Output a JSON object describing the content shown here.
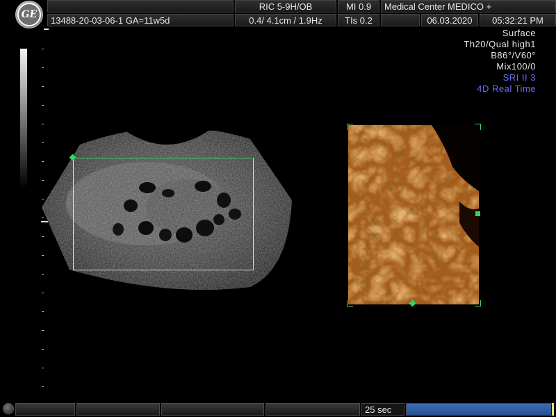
{
  "header": {
    "logo_text": "GE",
    "probe": "RIC 5-9H/OB",
    "mi": "MI  0.9",
    "institution": "Medical Center MEDICO +",
    "patient_id": "13488-20-03-06-1  GA=11w5d",
    "depth_freq": "0.4/ 4.1cm / 1.9Hz",
    "tis": "TIs  0.2",
    "date": "06.03.2020",
    "time": "05:32:21 PM"
  },
  "params": [
    {
      "text": "Surface",
      "color": "#e4e4e4"
    },
    {
      "text": "Th20/Qual high1",
      "color": "#e4e4e4"
    },
    {
      "text": "B86°/V60°",
      "color": "#e4e4e4"
    },
    {
      "text": "Mix100/0",
      "color": "#e4e4e4"
    },
    {
      "text": "SRI II 3",
      "color": "#6b6bff"
    },
    {
      "text": "4D Real Time",
      "color": "#6b6bff"
    }
  ],
  "footer": {
    "timer": "25 sec",
    "progress_fraction": 0.99
  },
  "colors": {
    "roi_green": "#3bd26c",
    "render_bronze": "#b8681f",
    "progress_blue": "#3d6eb8"
  }
}
